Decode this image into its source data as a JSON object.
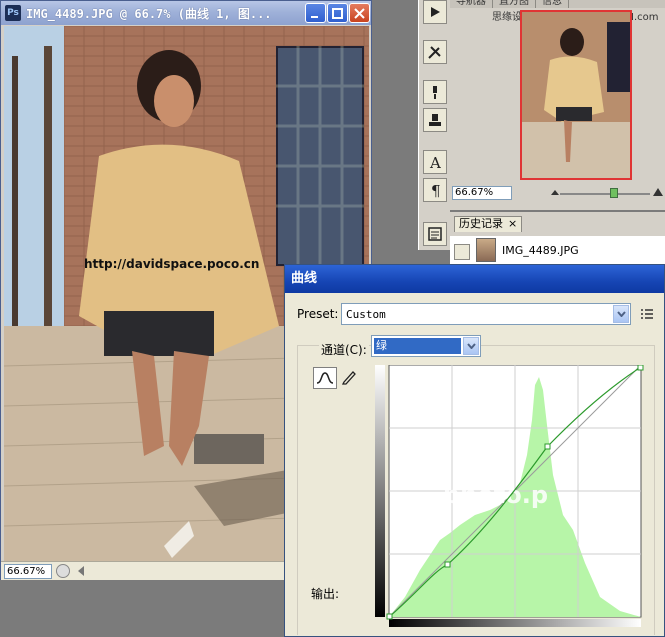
{
  "document": {
    "title": "IMG_4489.JPG @ 66.7% (曲线 1, 图...",
    "watermark": "http://davidspace.poco.cn",
    "zoom": "66.67%",
    "app_icon": "Ps"
  },
  "navigator": {
    "tabs": [
      "导航器",
      "直方图",
      "信息"
    ],
    "watermark": "思缘设计论坛 www.MISSYUAN.com",
    "zoom": "66.67%"
  },
  "history": {
    "tab_label": "历史记录",
    "item_label": "IMG_4489.JPG"
  },
  "curves": {
    "title": "曲线",
    "preset_label": "Preset:",
    "preset_value": "Custom",
    "channel_label": "通道(C):",
    "channel_value": "绿",
    "output_label": "输出:",
    "overlay_watermark": "photo.p"
  },
  "colors": {
    "curve": "#2c9a2c",
    "histogram": "#b7f5a8",
    "dialog_title": "#1645b4"
  },
  "icons": [
    "photoshop-icon",
    "minimize-icon",
    "maximize-icon",
    "close-icon",
    "play-icon",
    "tools-icon",
    "brush-icon",
    "stamp-icon",
    "type-icon",
    "paragraph-icon",
    "document-icon",
    "curve-tool-icon",
    "pencil-icon",
    "chevron-down-icon",
    "panel-menu-icon"
  ]
}
